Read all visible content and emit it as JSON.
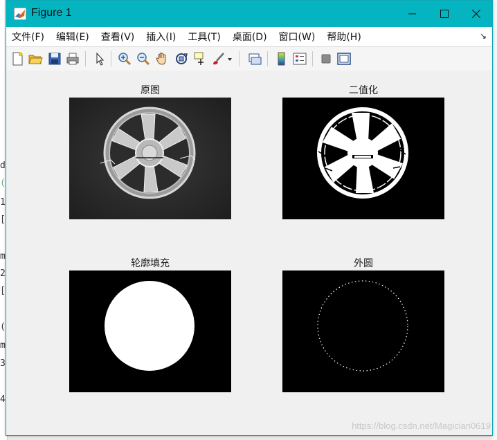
{
  "window": {
    "title": "Figure 1"
  },
  "menubar": {
    "items": [
      "文件(F)",
      "编辑(E)",
      "查看(V)",
      "插入(I)",
      "工具(T)",
      "桌面(D)",
      "窗口(W)",
      "帮助(H)"
    ]
  },
  "toolbar": {
    "buttons": [
      "new-figure-icon",
      "open-file-icon",
      "save-icon",
      "print-icon",
      "edit-plot-arrow-icon",
      "zoom-in-icon",
      "zoom-out-icon",
      "pan-hand-icon",
      "rotate-3d-icon",
      "data-cursor-icon",
      "brush-icon",
      "link-plot-icon",
      "colorbar-icon",
      "legend-icon",
      "hide-plot-tools-icon",
      "show-plot-tools-icon"
    ]
  },
  "subplots": [
    {
      "title": "原图",
      "image": "grayscale-wheel"
    },
    {
      "title": "二值化",
      "image": "binary-wheel"
    },
    {
      "title": "轮廓填充",
      "image": "filled-disc"
    },
    {
      "title": "外圆",
      "image": "dotted-circle"
    }
  ],
  "watermark": "https://blog.csdn.net/Magician0619",
  "colors": {
    "titlebar": "#05b4c1",
    "figure_background": "#f0f0f0",
    "axes_background": "#000000"
  }
}
